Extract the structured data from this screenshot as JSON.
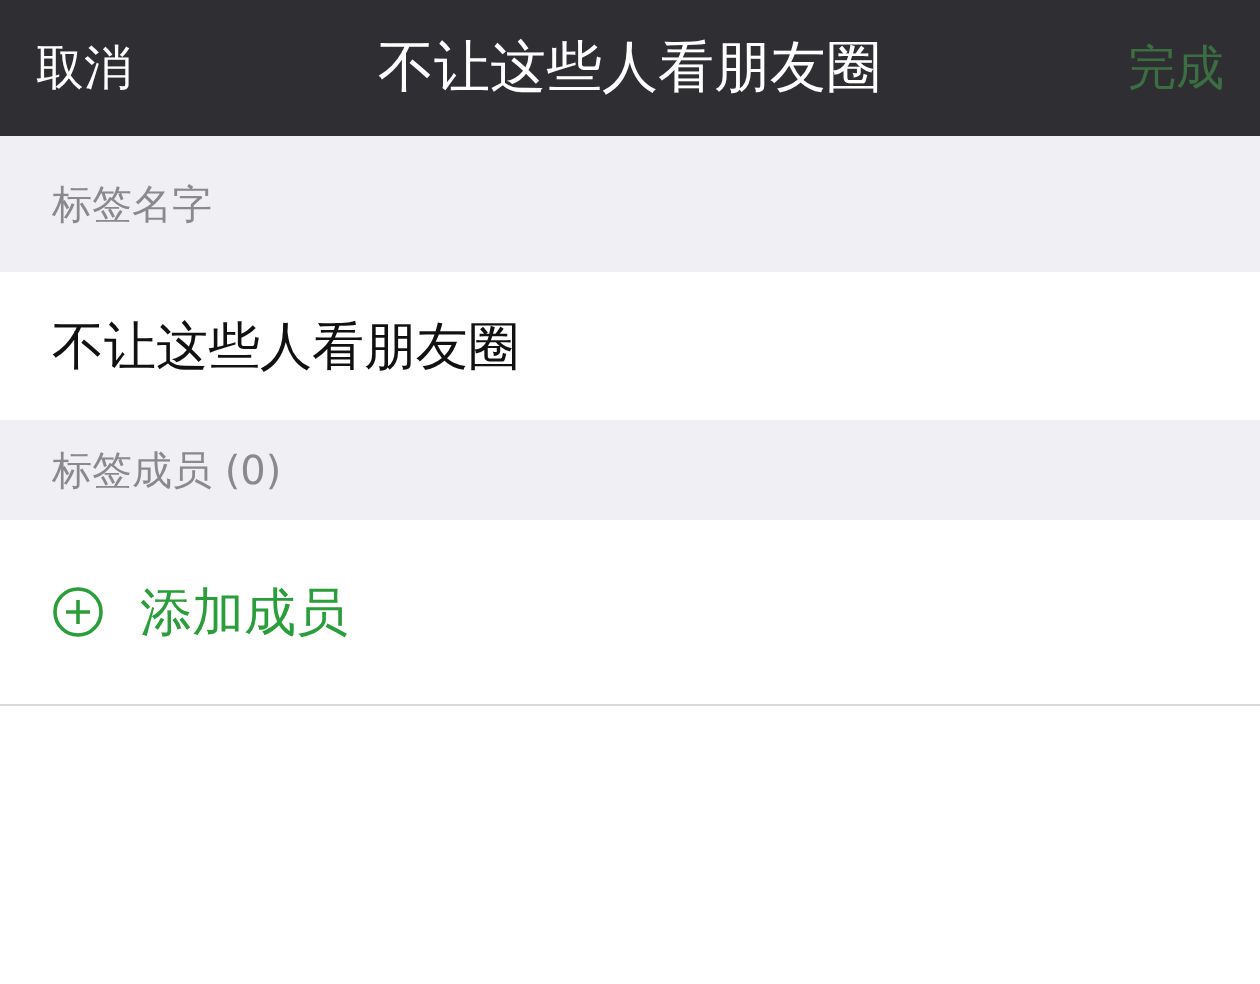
{
  "nav_bar": {
    "cancel": "取消",
    "title": "不让这些人看朋友圈",
    "done": {
      "label": "完成",
      "disabled": true
    }
  },
  "sections": [
    {
      "header": "标签名字",
      "kind": "text",
      "value": "不让这些人看朋友圈"
    },
    {
      "header": "标签成员 (0)",
      "kind": "add",
      "value": "添加成员"
    }
  ]
}
